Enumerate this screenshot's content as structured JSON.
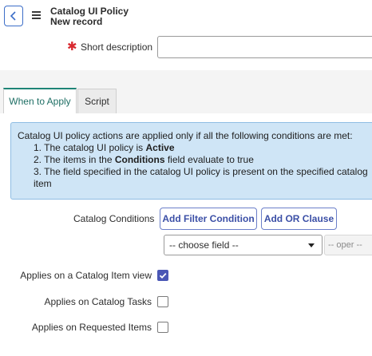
{
  "header": {
    "back_icon": "chevron-left-icon",
    "menu_icon": "hamburger-menu-icon",
    "title": "Catalog UI Policy",
    "subtitle": "New record"
  },
  "form": {
    "short_description": {
      "label": "Short description",
      "value": "",
      "required": true
    }
  },
  "tabs": [
    {
      "label": "When to Apply",
      "active": true
    },
    {
      "label": "Script",
      "active": false
    }
  ],
  "info": {
    "intro": "Catalog UI policy actions are applied only if all the following conditions are met:",
    "items": [
      {
        "prefix": "1. The catalog UI policy is ",
        "bold": "Active",
        "suffix": ""
      },
      {
        "prefix": "2. The items in the ",
        "bold": "Conditions",
        "suffix": " field evaluate to true"
      },
      {
        "prefix": "3. The field specified in the catalog UI policy is present on the specified catalog item",
        "bold": "",
        "suffix": ""
      }
    ]
  },
  "conditions": {
    "label": "Catalog Conditions",
    "add_filter_label": "Add Filter Condition",
    "add_or_label": "Add OR Clause",
    "field_select": "-- choose field --",
    "oper_select": "-- oper --"
  },
  "checkboxes": [
    {
      "label": "Applies on a Catalog Item view",
      "checked": true
    },
    {
      "label": "Applies on Catalog Tasks",
      "checked": false
    },
    {
      "label": "Applies on Requested Items",
      "checked": false
    }
  ],
  "colors": {
    "accent": "#1f8476",
    "button_text": "#3b4fa6",
    "checkbox_checked": "#4a57b5",
    "info_bg": "#cfe5f6",
    "required": "#d8292f"
  }
}
